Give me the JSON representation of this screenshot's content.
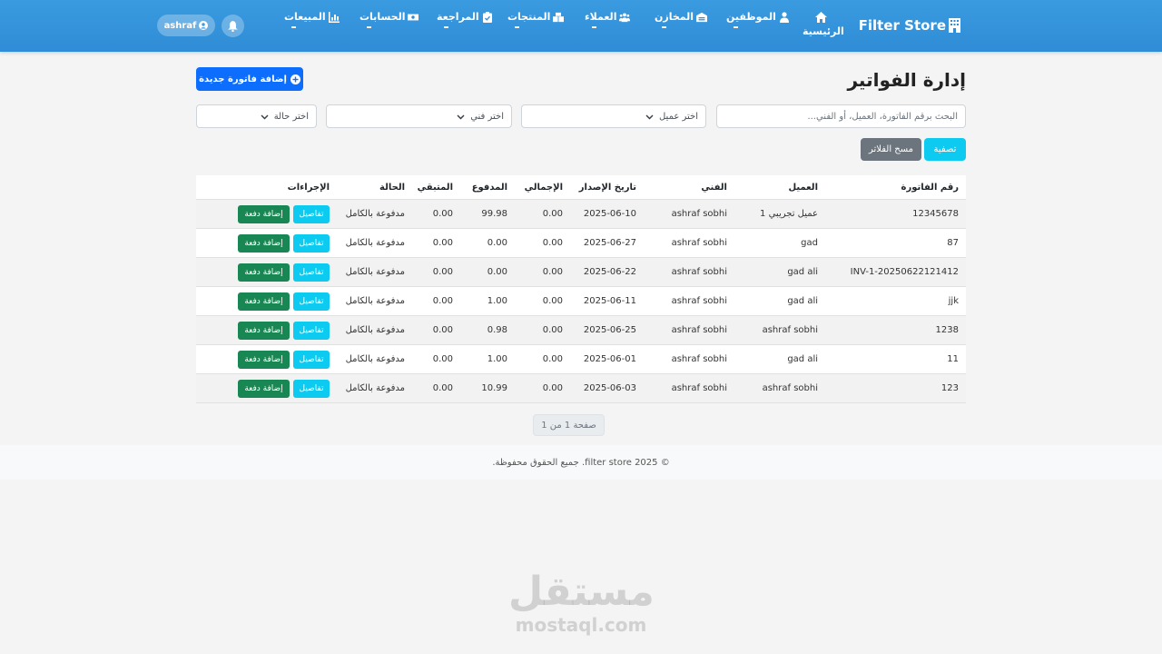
{
  "navbar": {
    "brand": "Filter Store",
    "home": "الرئيسية",
    "items": [
      {
        "label": "الموظفين",
        "icon": "user-tie-icon"
      },
      {
        "label": "المخازن",
        "icon": "warehouse-icon"
      },
      {
        "label": "العملاء",
        "icon": "users-icon"
      },
      {
        "label": "المنتجات",
        "icon": "boxes-icon"
      },
      {
        "label": "المراجعة",
        "icon": "clipboard-icon"
      },
      {
        "label": "الحسابات",
        "icon": "money-icon"
      },
      {
        "label": "المبيعات",
        "icon": "chart-icon"
      }
    ],
    "user": "ashraf"
  },
  "page": {
    "title": "إدارة الفواتير",
    "add_button": "إضافة فاتورة جديدة"
  },
  "filters": {
    "search_placeholder": "البحث برقم الفاتورة، العميل، أو الفني...",
    "client_select": "اختر عميل",
    "tech_select": "اختر فني",
    "status_select": "اختر حالة",
    "filter_button": "تصفية",
    "clear_button": "مسح الفلاتر"
  },
  "table": {
    "headers": [
      "رقم الفاتورة",
      "العميل",
      "الفني",
      "تاريخ الإصدار",
      "الإجمالي",
      "المدفوع",
      "المتبقي",
      "الحالة",
      "الإجراءات"
    ],
    "details_label": "تفاصيل",
    "add_payment_label": "إضافة دفعة",
    "rows": [
      {
        "invoice": "12345678",
        "client": "عميل تجريبي 1",
        "tech": "ashraf sobhi",
        "date": "2025-06-10",
        "total": "0.00",
        "paid": "99.98",
        "remaining": "0.00",
        "status": "مدفوعة بالكامل"
      },
      {
        "invoice": "87",
        "client": "gad",
        "tech": "ashraf sobhi",
        "date": "2025-06-27",
        "total": "0.00",
        "paid": "0.00",
        "remaining": "0.00",
        "status": "مدفوعة بالكامل"
      },
      {
        "invoice": "INV-1-20250622121412",
        "client": "gad ali",
        "tech": "ashraf sobhi",
        "date": "2025-06-22",
        "total": "0.00",
        "paid": "0.00",
        "remaining": "0.00",
        "status": "مدفوعة بالكامل"
      },
      {
        "invoice": "jjk",
        "client": "gad ali",
        "tech": "ashraf sobhi",
        "date": "2025-06-11",
        "total": "0.00",
        "paid": "1.00",
        "remaining": "0.00",
        "status": "مدفوعة بالكامل"
      },
      {
        "invoice": "1238",
        "client": "ashraf sobhi",
        "tech": "ashraf sobhi",
        "date": "2025-06-25",
        "total": "0.00",
        "paid": "0.98",
        "remaining": "0.00",
        "status": "مدفوعة بالكامل"
      },
      {
        "invoice": "11",
        "client": "gad ali",
        "tech": "ashraf sobhi",
        "date": "2025-06-01",
        "total": "0.00",
        "paid": "1.00",
        "remaining": "0.00",
        "status": "مدفوعة بالكامل"
      },
      {
        "invoice": "123",
        "client": "ashraf sobhi",
        "tech": "ashraf sobhi",
        "date": "2025-06-03",
        "total": "0.00",
        "paid": "10.99",
        "remaining": "0.00",
        "status": "مدفوعة بالكامل"
      }
    ]
  },
  "pagination": "صفحة 1 من 1",
  "footer": "© 2025 filter store. جميع الحقوق محفوظة.",
  "watermark": {
    "arabic": "مستقل",
    "latin": "mostaql.com"
  },
  "colors": {
    "navbar": "#3a9be0",
    "primary": "#0d6efd",
    "info": "#0dcaf0",
    "success": "#198754",
    "secondary": "#6c757d"
  }
}
